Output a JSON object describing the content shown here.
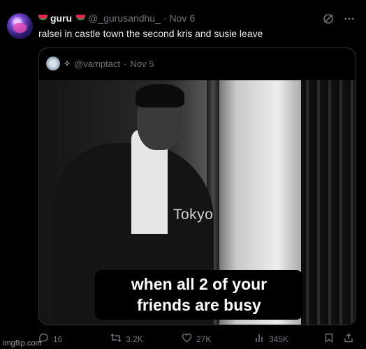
{
  "tweet": {
    "display_name": "guru",
    "handle": "@_gurusandhu_",
    "separator": "·",
    "date": "Nov 6",
    "text": "ralsei in castle town the second kris and susie leave",
    "icons": {
      "grok": "slashed-circle-icon",
      "more": "ellipsis-icon",
      "name_left": "watermelon-icon",
      "name_right": "watermelon-icon"
    }
  },
  "quote": {
    "sparkle": "✧",
    "handle": "@vamptact",
    "separator": "·",
    "date": "Nov 5",
    "image_watermark": "Tokyo",
    "caption_line1": "when all 2 of your",
    "caption_line2": "friends are busy"
  },
  "actions": {
    "replies": "16",
    "retweets": "3.2K",
    "likes": "27K",
    "views": "345K",
    "icons": {
      "reply": "reply-icon",
      "retweet": "retweet-icon",
      "like": "heart-icon",
      "views": "bar-chart-icon",
      "bookmark": "bookmark-icon",
      "share": "share-icon"
    }
  },
  "watermark": "imgflip.com",
  "colors": {
    "background": "#000000",
    "text": "#e7e9ea",
    "muted": "#71767b",
    "border": "#2f3336"
  }
}
